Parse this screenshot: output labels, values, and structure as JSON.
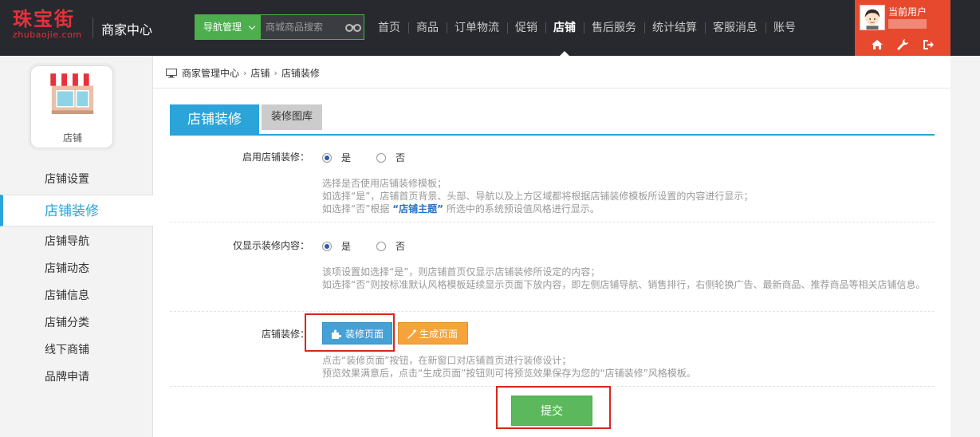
{
  "header": {
    "logo_main": "珠宝街",
    "logo_sub": "zhubaojie.com",
    "center_title": "商家中心",
    "nav_dropdown_label": "导航管理",
    "search_placeholder": "商城商品搜索",
    "nav_items": [
      "首页",
      "商品",
      "订单物流",
      "促销",
      "店铺",
      "售后服务",
      "统计结算",
      "客服消息",
      "账号"
    ],
    "active_nav_index": 4,
    "user_label": "当前用户",
    "accent": "#e6492d",
    "user_icons": [
      "home-icon",
      "wrench-icon",
      "logout-icon"
    ]
  },
  "sidebar": {
    "store_card_label": "店铺",
    "items": [
      "店铺设置",
      "店铺装修",
      "店铺导航",
      "店铺动态",
      "店铺信息",
      "店铺分类",
      "线下商铺",
      "品牌申请"
    ],
    "active_index": 1
  },
  "breadcrumb": [
    "商家管理中心",
    "店铺",
    "店铺装修"
  ],
  "tabs": {
    "active": "店铺装修",
    "second": "装修图库"
  },
  "form": {
    "enable": {
      "label": "启用店铺装修：",
      "yes": "是",
      "no": "否",
      "hint_line1": "选择是否使用店铺装修模板；",
      "hint_line2": "如选择“是”，店铺首页背景、头部、导航以及上方区域都将根据店铺装修模板所设置的内容进行显示；",
      "hint_line3_pre": "如选择“否”根据",
      "hint_line3_link": "“店铺主题”",
      "hint_line3_post": "所选中的系统预设值风格进行显示。"
    },
    "only_decor": {
      "label": "仅显示装修内容：",
      "yes": "是",
      "no": "否",
      "hint_line1": "该项设置如选择“是”，则店铺首页仅显示店铺装修所设定的内容；",
      "hint_line2": "如选择“否”则按标准默认风格模板延续显示页面下放内容，即左侧店铺导航、销售排行，右侧轮换广告、最新商品、推荐商品等相关店铺信息。"
    },
    "decor": {
      "label": "店铺装修：",
      "decor_button": "装修页面",
      "generate_button": "生成页面",
      "hint_line1": "点击“装修页面”按钮，在新窗口对店铺首页进行装修设计；",
      "hint_line2": "预览效果满意后，点击“生成页面”按钮则可将预览效果保存为您的“店铺装修”风格模板。"
    },
    "submit": "提交"
  }
}
